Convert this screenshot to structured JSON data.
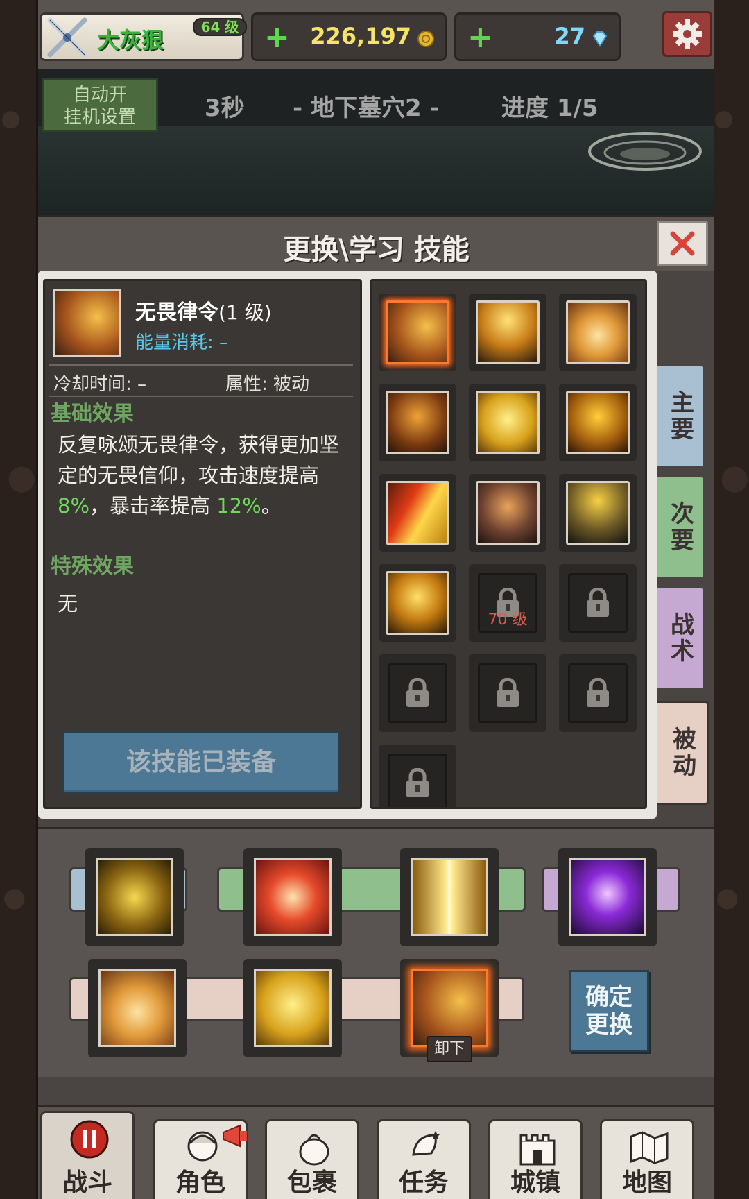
{
  "player": {
    "name": "大灰狠",
    "level": "64 级"
  },
  "resources": {
    "gold": "226,197",
    "gems": "27",
    "gold_plus": "+",
    "gem_plus": "+"
  },
  "battle": {
    "auto_button": "自动开\n挂机设置",
    "auto_line1": "自动开",
    "auto_line2": "挂机设置",
    "timer": "3秒",
    "stage": "-  地下墓穴2  -",
    "progress": "进度 1/5"
  },
  "panel": {
    "title": "更换\\学习 技能"
  },
  "skill_detail": {
    "name": "无畏律令",
    "level": "(1 级)",
    "energy": "能量消耗: –",
    "cooldown": "冷却时间: –",
    "attribute": "属性: 被动",
    "basic_title": "基础效果",
    "desc_part1": "反复咏颂无畏律令，获得更加坚定的无畏信仰，攻击速度提高 ",
    "desc_value1": "8%",
    "desc_part2": "，暴击率提高 ",
    "desc_value2": "12%",
    "desc_part3": "。",
    "special_title": "特殊效果",
    "special_text": "无",
    "equipped_button": "该技能已装备"
  },
  "skill_grid": {
    "locked_level": "70 级"
  },
  "tabs": {
    "primary": "主要",
    "secondary": "次要",
    "tactics": "战术",
    "passive": "被动"
  },
  "loadout": {
    "unequip": "卸下",
    "confirm_line1": "确定",
    "confirm_line2": "更换"
  },
  "nav": {
    "battle": "战斗",
    "character": "角色",
    "bag": "包裹",
    "quest": "任务",
    "town": "城镇",
    "map": "地图"
  },
  "colors": {
    "accent_green": "#6fa662",
    "highlight_green": "#6fda5a",
    "energy_blue": "#5ac8e6",
    "selected_orange": "#ff7a2a",
    "tab_primary": "#a9bfd2",
    "tab_secondary": "#8fbf8c",
    "tab_tactics": "#c6a9d3",
    "tab_passive": "#e6cfc4"
  }
}
